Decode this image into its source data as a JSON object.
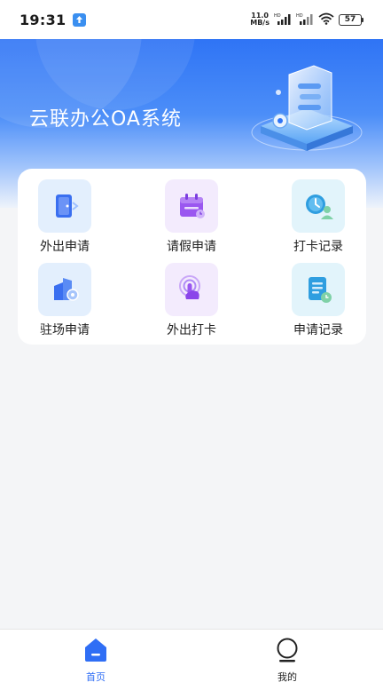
{
  "status_bar": {
    "time": "19:31",
    "speed_value": "11.0",
    "speed_unit": "MB/s",
    "battery": "57"
  },
  "banner": {
    "title": "云联办公OA系统"
  },
  "menu": {
    "items": [
      {
        "label": "外出申请",
        "icon": "door-exit-icon",
        "color": "#3a6ff0"
      },
      {
        "label": "请假申请",
        "icon": "calendar-icon",
        "color": "#9a57f0"
      },
      {
        "label": "打卡记录",
        "icon": "clock-user-icon",
        "color": "#2f9ee0"
      },
      {
        "label": "驻场申请",
        "icon": "building-pin-icon",
        "color": "#3a6ff0"
      },
      {
        "label": "外出打卡",
        "icon": "finger-tap-icon",
        "color": "#9a57f0"
      },
      {
        "label": "申请记录",
        "icon": "document-clock-icon",
        "color": "#2f9ee0"
      }
    ]
  },
  "bottom_nav": {
    "tabs": [
      {
        "label": "首页",
        "icon": "home-icon",
        "active": true
      },
      {
        "label": "我的",
        "icon": "user-icon",
        "active": false
      }
    ],
    "active_color": "#2f6ef5"
  }
}
